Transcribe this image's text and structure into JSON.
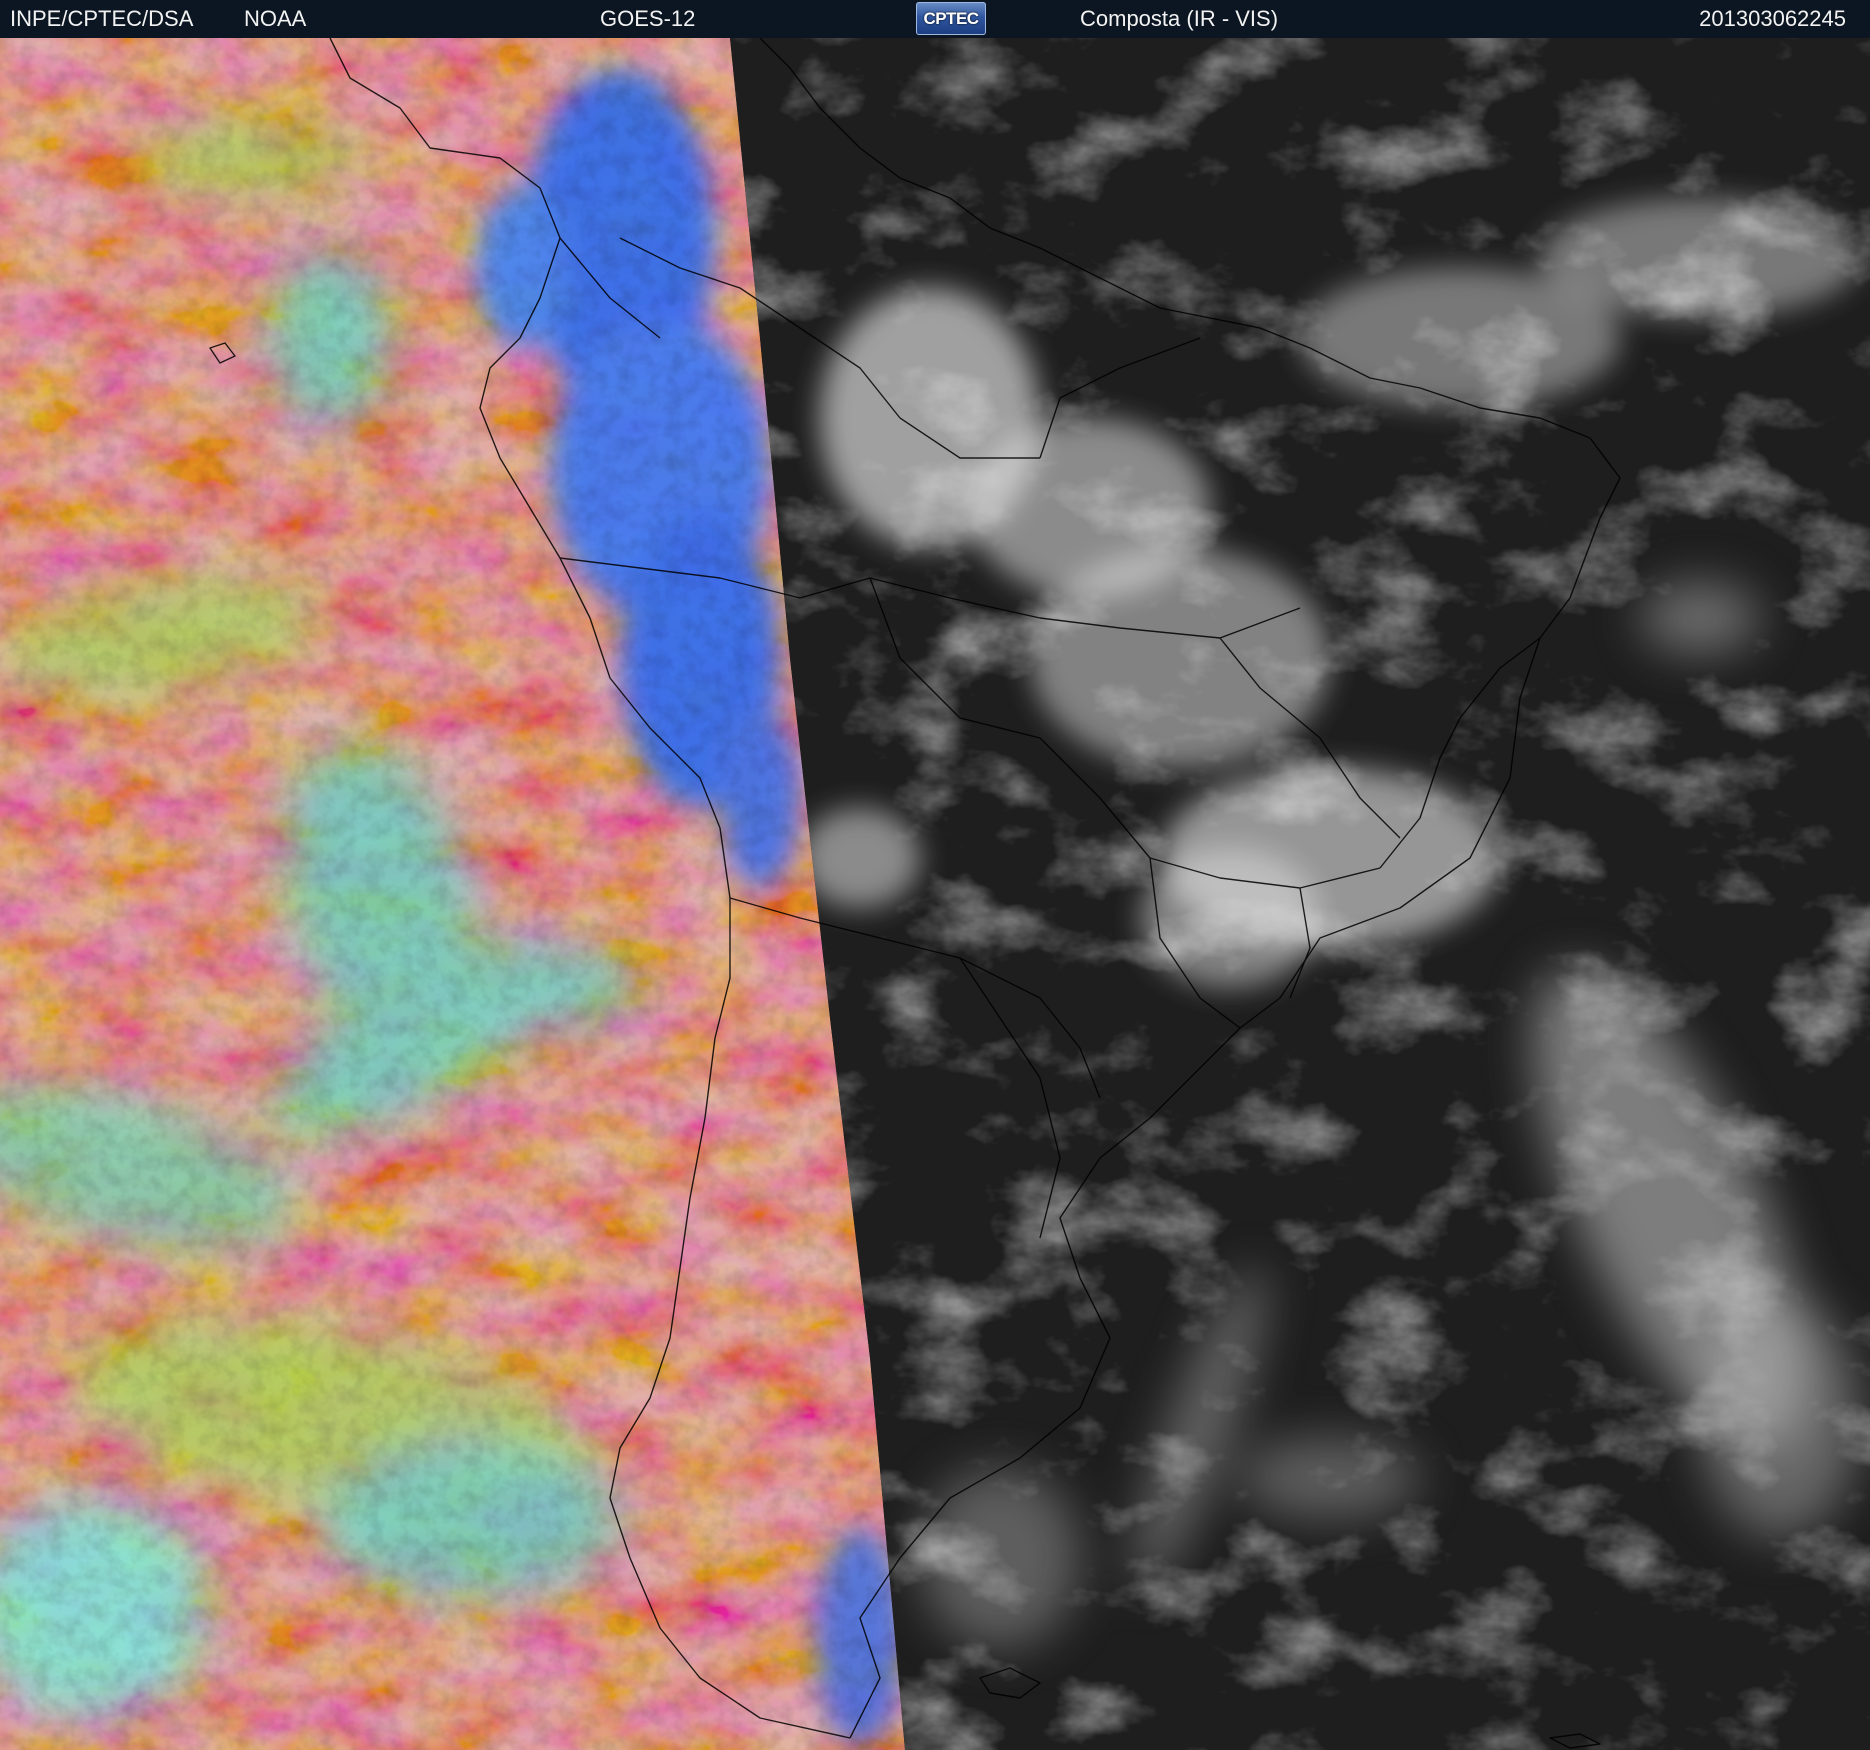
{
  "header": {
    "agency": "INPE/CPTEC/DSA",
    "source": "NOAA",
    "satellite": "GOES-12",
    "logo_text": "CPTEC",
    "product": "Composta (IR - VIS)",
    "timestamp": "201303062245"
  },
  "icons": {
    "logo": "cptec-logo-icon"
  },
  "colors": {
    "header_bg": "#0b1622",
    "ir_ocean": "#c9544a",
    "ir_cloud_high": "#2f6cf0",
    "ir_cloud_mid": "#5fd8c8",
    "ir_cloud_low": "#a6d65a",
    "vis_ocean": "#1e1e1e",
    "vis_cloud": "#e6e6e6",
    "borders": "#000000"
  }
}
